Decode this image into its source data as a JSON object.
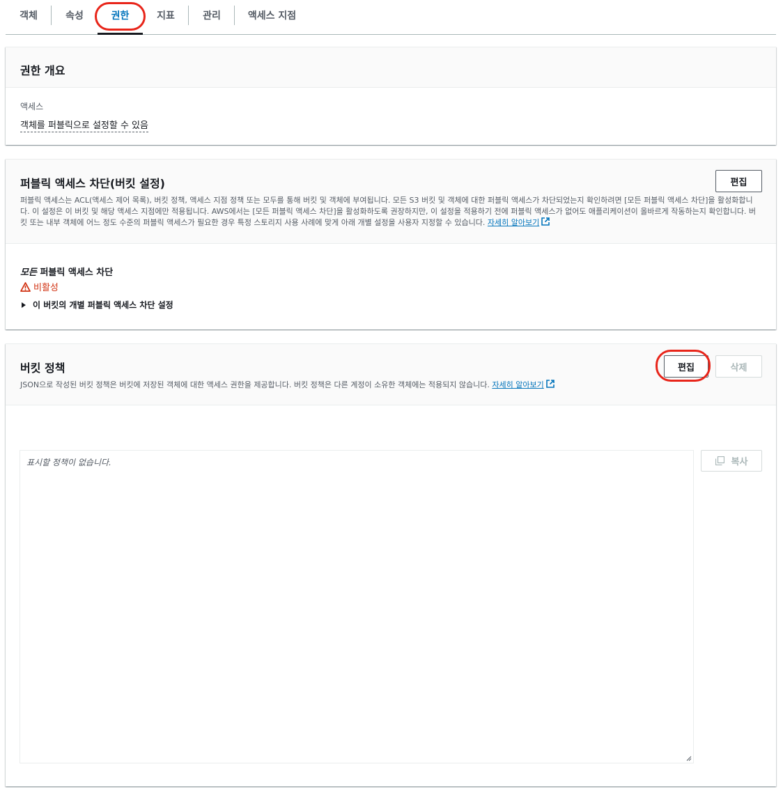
{
  "tabs": [
    {
      "label": "객체"
    },
    {
      "label": "속성"
    },
    {
      "label": "권한",
      "active": true
    },
    {
      "label": "지표"
    },
    {
      "label": "관리"
    },
    {
      "label": "액세스 지점"
    }
  ],
  "overview": {
    "title": "권한 개요",
    "access_label": "액세스",
    "access_value": "객체를 퍼블릭으로 설정할 수 있음"
  },
  "block_public": {
    "title": "퍼블릭 액세스 차단(버킷 설정)",
    "edit_label": "편집",
    "description": "퍼블릭 액세스는 ACL(액세스 제어 목록), 버킷 정책, 액세스 지점 정책 또는 모두를 통해 버킷 및 객체에 부여됩니다. 모든 S3 버킷 및 객체에 대한 퍼블릭 액세스가 차단되었는지 확인하려면 [모든 퍼블릭 액세스 차단]을 활성화합니다. 이 설정은 이 버킷 및 해당 액세스 지점에만 적용됩니다. AWS에서는 [모든 퍼블릭 액세스 차단]을 활성화하도록 권장하지만, 이 설정을 적용하기 전에 퍼블릭 액세스가 없어도 애플리케이션이 올바르게 작동하는지 확인합니다. 버킷 또는 내부 객체에 어느 정도 수준의 퍼블릭 액세스가 필요한 경우 특정 스토리지 사용 사례에 맞게 아래 개별 설정을 사용자 지정할 수 있습니다.",
    "learn_more": "자세히 알아보기",
    "block_all_prefix": "모든",
    "block_all_suffix": " 퍼블릭 액세스 차단",
    "status": "비활성",
    "expand_label": "이 버킷의 개별 퍼블릭 액세스 차단 설정"
  },
  "bucket_policy": {
    "title": "버킷 정책",
    "description": "JSON으로 작성된 버킷 정책은 버킷에 저장된 객체에 대한 액세스 권한을 제공합니다. 버킷 정책은 다른 계정이 소유한 객체에는 적용되지 않습니다.",
    "learn_more": "자세히 알아보기",
    "edit_label": "편집",
    "delete_label": "삭제",
    "placeholder": "표시할 정책이 없습니다.",
    "copy_label": "복사"
  },
  "colors": {
    "accent": "#0073bb",
    "warning": "#d13212",
    "annotation": "#e8251a"
  }
}
